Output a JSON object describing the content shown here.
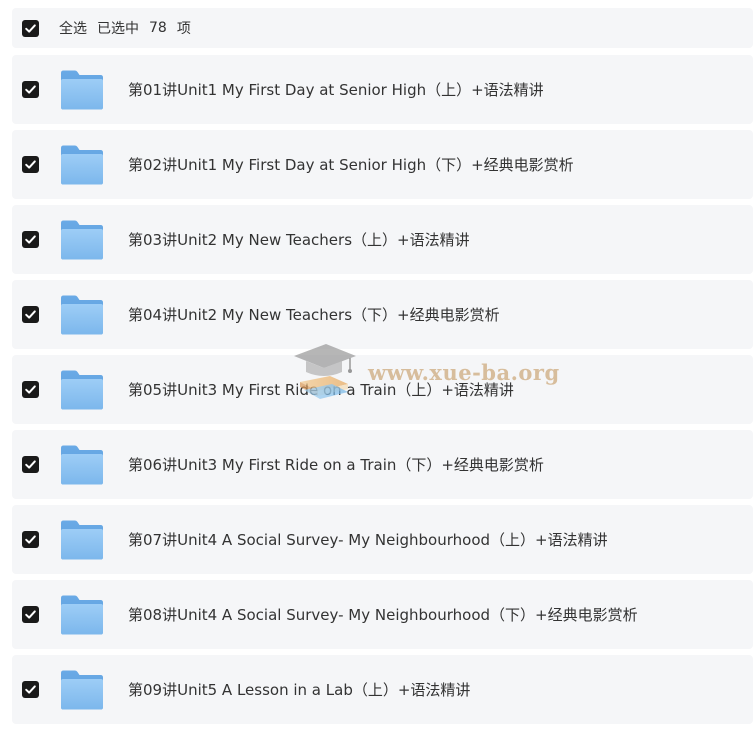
{
  "header": {
    "select_all_label": "全选",
    "selected_label": "已选中",
    "selected_count": "78",
    "items_unit": "项"
  },
  "folders": [
    {
      "name": "第01讲Unit1 My First Day at Senior High（上）+语法精讲"
    },
    {
      "name": "第02讲Unit1 My First Day at Senior High（下）+经典电影赏析"
    },
    {
      "name": "第03讲Unit2 My New Teachers（上）+语法精讲"
    },
    {
      "name": "第04讲Unit2 My New Teachers（下）+经典电影赏析"
    },
    {
      "name": "第05讲Unit3 My First Ride on a Train（上）+语法精讲"
    },
    {
      "name": "第06讲Unit3 My First Ride on a Train（下）+经典电影赏析"
    },
    {
      "name": "第07讲Unit4 A Social Survey- My Neighbourhood（上）+语法精讲"
    },
    {
      "name": "第08讲Unit4 A Social Survey- My Neighbourhood（下）+经典电影赏析"
    },
    {
      "name": "第09讲Unit5 A Lesson in a Lab（上）+语法精讲"
    }
  ],
  "watermark": {
    "text": "www.xue-ba.org"
  },
  "colors": {
    "row_background": "#f5f6f8",
    "checkbox": "#1a1a1a",
    "folder_blue": "#7ab6ec",
    "text": "#333333"
  }
}
